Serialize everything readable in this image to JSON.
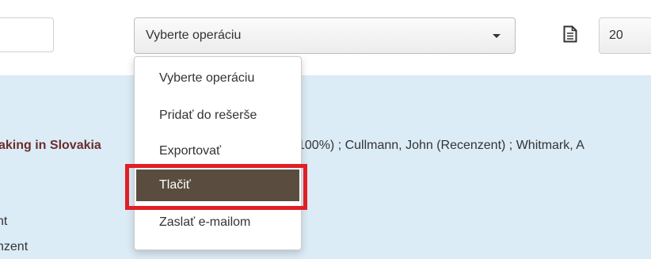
{
  "toolbar": {
    "operation_select": {
      "value": "Vyberte operáciu"
    },
    "per_page": {
      "value": "20"
    }
  },
  "dropdown": {
    "items": [
      {
        "label": "Vyberte operáciu"
      },
      {
        "label": "Pridať do rešerše"
      },
      {
        "label": "Exportovať"
      },
      {
        "label": "Tlačiť"
      },
      {
        "label": "Zaslať e-mailom"
      }
    ],
    "active_item": "Tlačiť"
  },
  "result": {
    "title_fragment": "aking in Slovakia",
    "authors_fragment": "100%) ; Cullmann, John (Recenzent) ; Whitmark, A",
    "role_line_1": "nt",
    "role_line_2": "nzent"
  },
  "colors": {
    "results_bg": "#dcecf6",
    "active_item_bg": "#5a4d3f",
    "highlight_border": "#e01f26",
    "title_color": "#6b2d2d"
  },
  "icons": {
    "print_preview": "document-icon"
  }
}
